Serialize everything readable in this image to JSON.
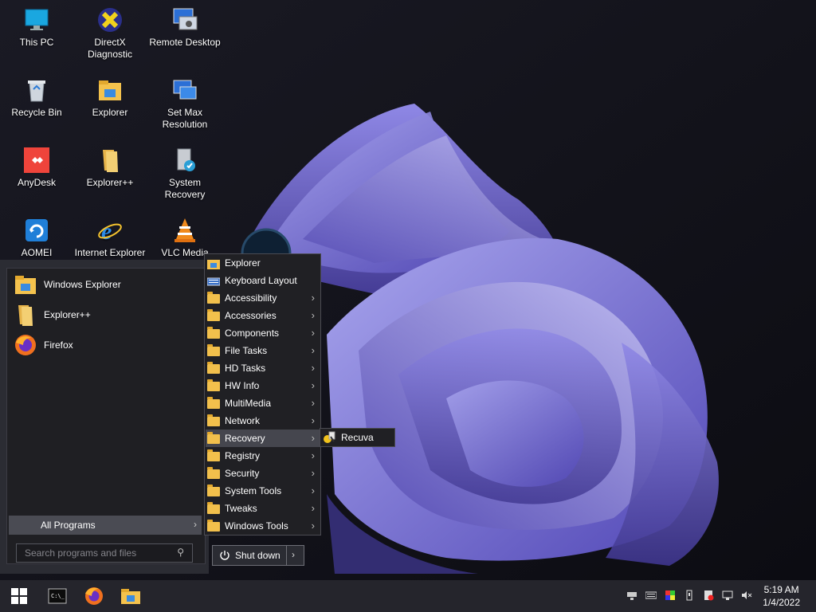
{
  "desktop": {
    "icons": [
      {
        "label": "This PC",
        "icon": "monitor-icon"
      },
      {
        "label": "DirectX Diagnostic",
        "icon": "directx-icon"
      },
      {
        "label": "Remote Desktop",
        "icon": "remote-desktop-icon"
      },
      {
        "label": "Recycle Bin",
        "icon": "recycle-bin-icon"
      },
      {
        "label": "Explorer",
        "icon": "folder-icon"
      },
      {
        "label": "Set Max Resolution",
        "icon": "display-settings-icon"
      },
      {
        "label": "AnyDesk",
        "icon": "anydesk-icon"
      },
      {
        "label": "Explorer++",
        "icon": "folder-icon"
      },
      {
        "label": "System Recovery",
        "icon": "recovery-icon"
      },
      {
        "label": "AOMEI Backupper",
        "icon": "aomei-icon"
      },
      {
        "label": "Internet Explorer",
        "icon": "internet-explorer-icon"
      },
      {
        "label": "VLC Media Player",
        "icon": "vlc-icon"
      }
    ]
  },
  "start_menu": {
    "pinned": [
      {
        "label": "Windows Explorer",
        "icon": "folder-icon"
      },
      {
        "label": "Explorer++",
        "icon": "folder-icon"
      },
      {
        "label": "Firefox",
        "icon": "firefox-icon"
      }
    ],
    "all_programs_label": "All Programs",
    "search_placeholder": "Search programs and files",
    "shutdown_label": "Shut down"
  },
  "programs_menu": {
    "items": [
      {
        "label": "Explorer",
        "icon": "explorer-icon",
        "submenu": false
      },
      {
        "label": "Keyboard Layout",
        "icon": "keyboard-icon",
        "submenu": false
      },
      {
        "label": "Accessibility",
        "icon": "folder-icon",
        "submenu": true
      },
      {
        "label": "Accessories",
        "icon": "folder-icon",
        "submenu": true
      },
      {
        "label": "Components",
        "icon": "folder-icon",
        "submenu": true
      },
      {
        "label": "File Tasks",
        "icon": "folder-icon",
        "submenu": true
      },
      {
        "label": "HD Tasks",
        "icon": "folder-icon",
        "submenu": true
      },
      {
        "label": "HW Info",
        "icon": "folder-icon",
        "submenu": true
      },
      {
        "label": "MultiMedia",
        "icon": "folder-icon",
        "submenu": true
      },
      {
        "label": "Network",
        "icon": "folder-icon",
        "submenu": true
      },
      {
        "label": "Recovery",
        "icon": "folder-icon",
        "submenu": true,
        "active": true
      },
      {
        "label": "Registry",
        "icon": "folder-icon",
        "submenu": true
      },
      {
        "label": "Security",
        "icon": "folder-icon",
        "submenu": true
      },
      {
        "label": "System Tools",
        "icon": "folder-icon",
        "submenu": true
      },
      {
        "label": "Tweaks",
        "icon": "folder-icon",
        "submenu": true
      },
      {
        "label": "Windows Tools",
        "icon": "folder-icon",
        "submenu": true
      }
    ],
    "recovery_submenu": [
      {
        "label": "Recuva",
        "icon": "recuva-icon"
      }
    ]
  },
  "taskbar": {
    "apps": [
      "start-icon",
      "command-prompt-icon",
      "firefox-icon",
      "file-explorer-icon"
    ],
    "tray_icons": [
      "network-drive-icon",
      "keyboard-icon",
      "color-icon",
      "usb-icon",
      "security-icon",
      "network-icon",
      "volume-muted-icon"
    ],
    "time": "5:19 AM",
    "date": "1/4/2022"
  },
  "colors": {
    "accent": "#6c63d9",
    "folder": "#f2c04c",
    "menu_bg": "#202024",
    "taskbar_bg": "#25252c"
  }
}
